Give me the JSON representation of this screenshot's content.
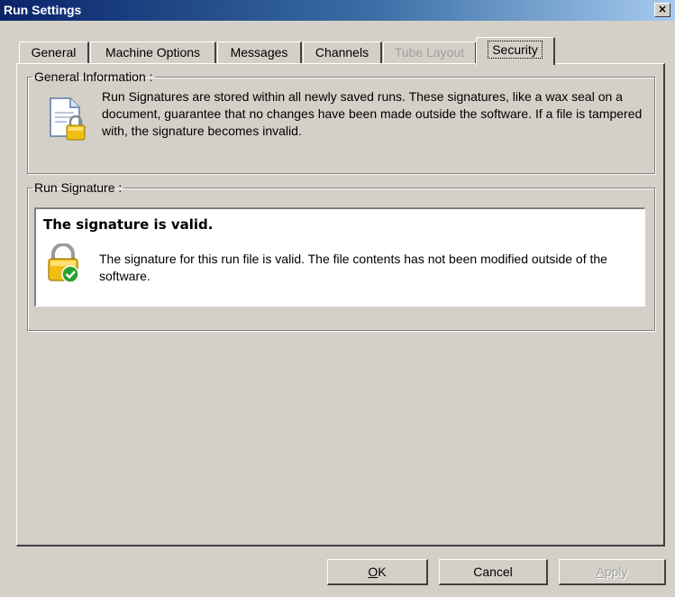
{
  "window": {
    "title": "Run Settings",
    "close_glyph": "×"
  },
  "tabs": [
    {
      "label": "General",
      "state": "normal"
    },
    {
      "label": "Machine Options",
      "state": "normal"
    },
    {
      "label": "Messages",
      "state": "normal"
    },
    {
      "label": "Channels",
      "state": "normal"
    },
    {
      "label": "Tube Layout",
      "state": "disabled"
    },
    {
      "label": "Security",
      "state": "active"
    }
  ],
  "general_information": {
    "label": "General Information :",
    "icon": "document-lock-icon",
    "text": "Run Signatures are stored within all newly saved runs. These signatures, like a wax seal on a document, guarantee that no changes have been made outside the software. If a file is tampered with, the signature becomes invalid."
  },
  "run_signature": {
    "label": "Run Signature :",
    "status_title": "The signature is valid.",
    "icon": "lock-check-icon",
    "status_text": "The signature for this run file is valid. The file contents has not been modified outside of the software."
  },
  "buttons": {
    "ok_mnemonic": "O",
    "ok_rest": "K",
    "cancel": "Cancel",
    "apply_mnemonic": "A",
    "apply_rest": "pply"
  },
  "colors": {
    "titlebar_start": "#0a246a",
    "titlebar_end": "#a6caf0",
    "face": "#d4d0c8",
    "lock_gold": "#e8b400",
    "check_green": "#2aa02a"
  }
}
